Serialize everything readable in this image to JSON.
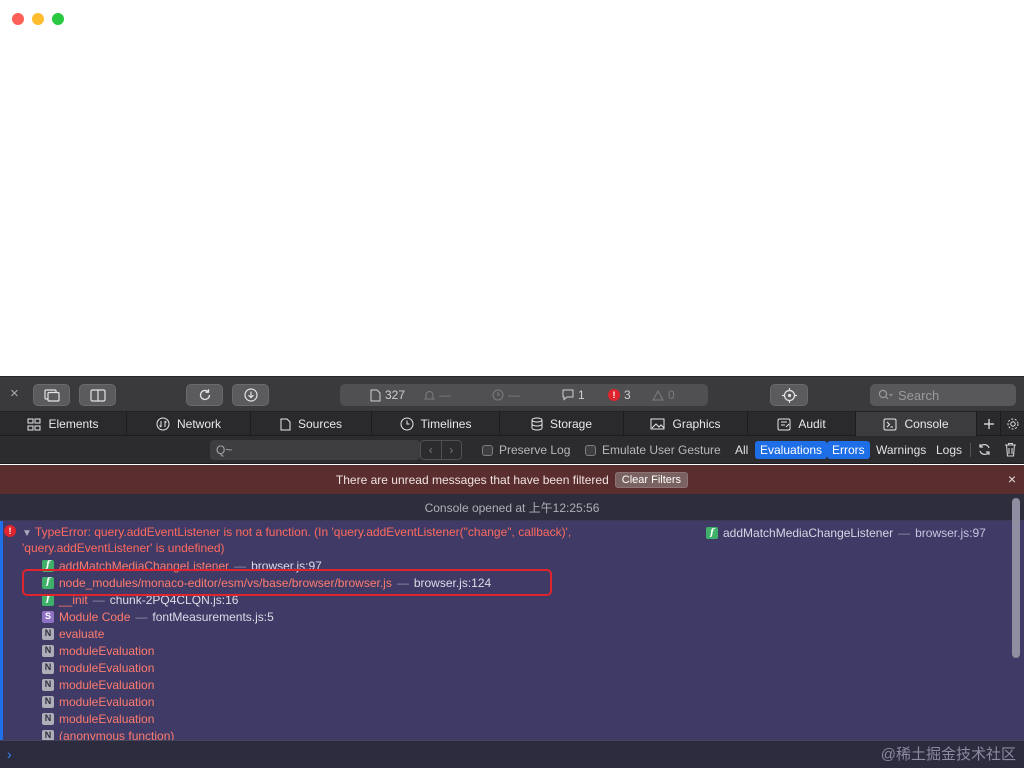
{
  "window": {
    "traffic_lights": [
      "close",
      "minimize",
      "zoom"
    ],
    "colors": {
      "red": "#fe5f57",
      "yellow": "#febc2e",
      "green": "#28c840"
    }
  },
  "toolbar": {
    "close_glyph": "×",
    "resources_count": "327",
    "idle_dash_1": "—",
    "idle_dash_2": "—",
    "logs_count": "1",
    "errors_count": "3",
    "warnings_count": "0",
    "search_placeholder": "Search"
  },
  "tabs": [
    {
      "label": "Elements",
      "icon": "elements-icon"
    },
    {
      "label": "Network",
      "icon": "network-icon"
    },
    {
      "label": "Sources",
      "icon": "sources-icon"
    },
    {
      "label": "Timelines",
      "icon": "timelines-icon"
    },
    {
      "label": "Storage",
      "icon": "storage-icon"
    },
    {
      "label": "Graphics",
      "icon": "graphics-icon"
    },
    {
      "label": "Audit",
      "icon": "audit-icon"
    },
    {
      "label": "Console",
      "icon": "console-icon",
      "active": true
    }
  ],
  "filterbar": {
    "filter_glyph": "Q~",
    "preserve_log": "Preserve Log",
    "emulate_gesture": "Emulate User Gesture",
    "scopes": [
      "All",
      "Evaluations",
      "Errors",
      "Warnings",
      "Logs"
    ],
    "selected_scopes": [
      "Evaluations",
      "Errors"
    ]
  },
  "banner": {
    "text": "There are unread messages that have been filtered",
    "clear_label": "Clear Filters",
    "close_glyph": "×"
  },
  "console": {
    "opened_text": "Console opened at 上午12:25:56",
    "error": {
      "line1": "TypeError: query.addEventListener is not a function. (In 'query.addEventListener(\"change\", callback)',",
      "line2": "'query.addEventListener' is undefined)",
      "location_fn": "addMatchMediaChangeListener",
      "location_sep": "—",
      "location_file": "browser.js:97"
    },
    "frames": [
      {
        "badge": "f",
        "fn": "addMatchMediaChangeListener",
        "file": "browser.js:97"
      },
      {
        "badge": "f",
        "fn": "node_modules/monaco-editor/esm/vs/base/browser/browser.js",
        "file": "browser.js:124"
      },
      {
        "badge": "f",
        "fn": "__init",
        "file": "chunk-2PQ4CLQN.js:16"
      },
      {
        "badge": "S",
        "fn": "Module Code",
        "file": "fontMeasurements.js:5"
      },
      {
        "badge": "N",
        "fn": "evaluate",
        "file": ""
      },
      {
        "badge": "N",
        "fn": "moduleEvaluation",
        "file": ""
      },
      {
        "badge": "N",
        "fn": "moduleEvaluation",
        "file": ""
      },
      {
        "badge": "N",
        "fn": "moduleEvaluation",
        "file": ""
      },
      {
        "badge": "N",
        "fn": "moduleEvaluation",
        "file": ""
      },
      {
        "badge": "N",
        "fn": "moduleEvaluation",
        "file": ""
      },
      {
        "badge": "N",
        "fn": "(anonymous function)",
        "file": ""
      }
    ],
    "frame_sep": "—"
  },
  "prompt": {
    "caret": "›",
    "watermark": "@稀土掘金技术社区"
  }
}
